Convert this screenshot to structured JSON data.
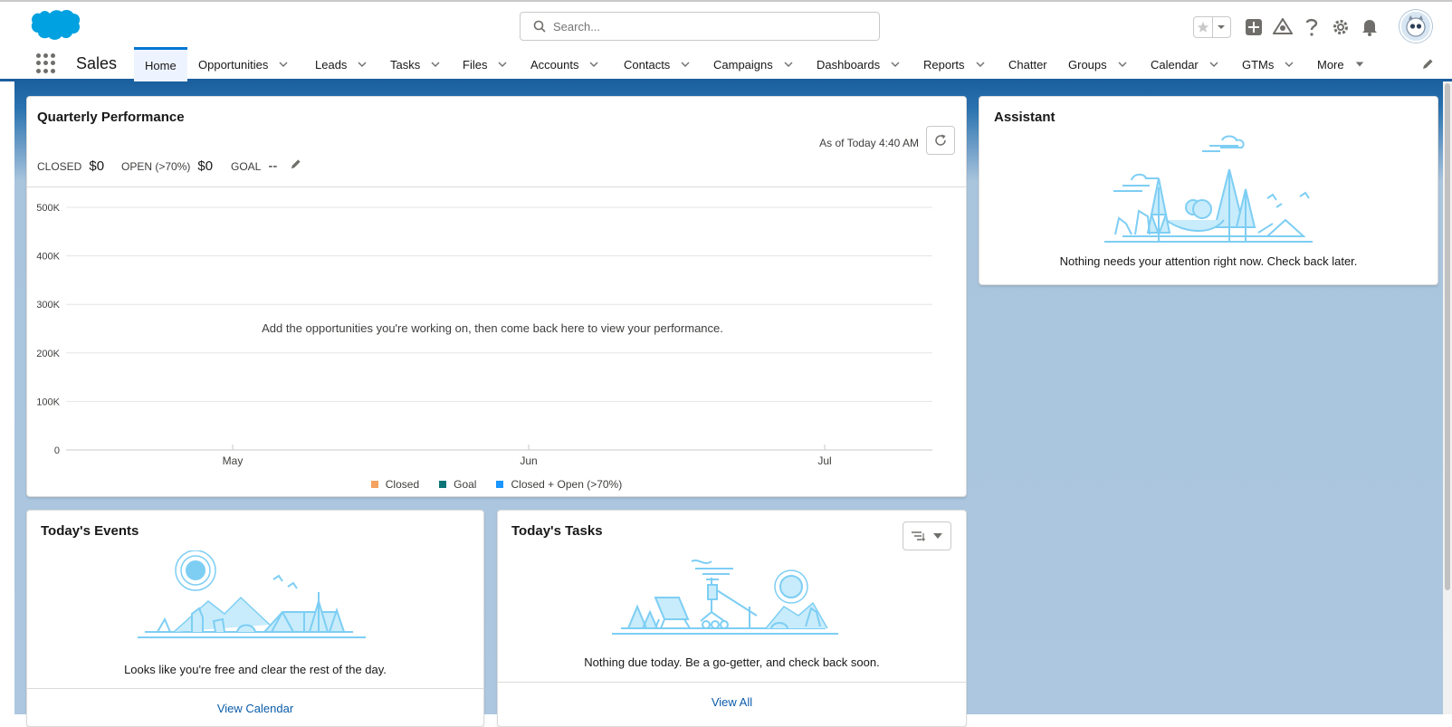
{
  "search": {
    "placeholder": "Search..."
  },
  "nav": {
    "app_name": "Sales",
    "items": [
      {
        "label": "Home"
      },
      {
        "label": "Opportunities"
      },
      {
        "label": "Leads"
      },
      {
        "label": "Tasks"
      },
      {
        "label": "Files"
      },
      {
        "label": "Accounts"
      },
      {
        "label": "Contacts"
      },
      {
        "label": "Campaigns"
      },
      {
        "label": "Dashboards"
      },
      {
        "label": "Reports"
      },
      {
        "label": "Chatter"
      },
      {
        "label": "Groups"
      },
      {
        "label": "Calendar"
      },
      {
        "label": "GTMs"
      },
      {
        "label": "More"
      }
    ]
  },
  "quarterly": {
    "title": "Quarterly Performance",
    "as_of": "As of Today 4:40 AM",
    "closed_label": "CLOSED",
    "closed_value": "$0",
    "open_label": "OPEN (>70%)",
    "open_value": "$0",
    "goal_label": "GOAL",
    "goal_value": "--",
    "empty_message": "Add the opportunities you're working on, then come back here to view your performance."
  },
  "chart_data": {
    "type": "line",
    "x": [
      "May",
      "Jun",
      "Jul"
    ],
    "yticks": [
      "500K",
      "400K",
      "300K",
      "200K",
      "100K",
      "0"
    ],
    "ylim": [
      0,
      500000
    ],
    "series": [
      {
        "name": "Closed",
        "color": "#f4a261",
        "values": []
      },
      {
        "name": "Goal",
        "color": "#0b7477",
        "values": []
      },
      {
        "name": "Closed + Open (>70%)",
        "color": "#1b96ff",
        "values": []
      }
    ],
    "legend": "bottom",
    "grid": true
  },
  "assistant": {
    "title": "Assistant",
    "message": "Nothing needs your attention right now. Check back later."
  },
  "events": {
    "title": "Today's Events",
    "message": "Looks like you're free and clear the rest of the day.",
    "link": "View Calendar"
  },
  "tasks": {
    "title": "Today's Tasks",
    "message": "Nothing due today. Be a go-getter, and check back soon.",
    "link": "View All"
  },
  "colors": {
    "brand": "#00a1e0",
    "nav_accent": "#0176d3",
    "illustration": "#7ecef4"
  }
}
